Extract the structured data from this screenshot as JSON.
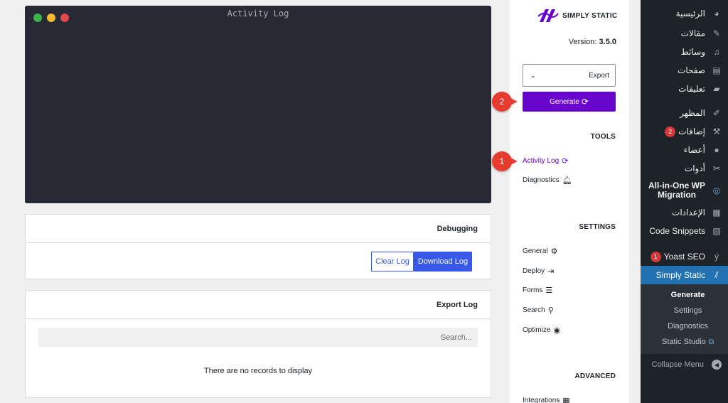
{
  "wp_menu": {
    "items": [
      {
        "label": "الرئيسية",
        "icon": "dashboard-icon"
      },
      {
        "label": "مقالات",
        "icon": "pin-icon"
      },
      {
        "label": "وسائط",
        "icon": "media-icon"
      },
      {
        "label": "صفحات",
        "icon": "pages-icon"
      },
      {
        "label": "تعليقات",
        "icon": "comments-icon"
      },
      {
        "label": "المظهر",
        "icon": "appearance-icon"
      },
      {
        "label": "إضافات",
        "icon": "plugins-icon",
        "badge": "2"
      },
      {
        "label": "أعضاء",
        "icon": "users-icon"
      },
      {
        "label": "أدوات",
        "icon": "tools-icon"
      },
      {
        "label": "All-in-One WP Migration",
        "icon": "migration-icon"
      },
      {
        "label": "الإعدادات",
        "icon": "settings-icon"
      },
      {
        "label": "Code Snippets",
        "icon": "code-snippets-icon"
      },
      {
        "label": "Yoast SEO",
        "icon": "yoast-icon",
        "badge": "1"
      },
      {
        "label": "Simply Static",
        "icon": "simply-static-icon"
      }
    ],
    "submenu": [
      {
        "label": "Generate"
      },
      {
        "label": "Settings"
      },
      {
        "label": "Diagnostics"
      },
      {
        "label": "Static Studio"
      }
    ],
    "collapse_label": "Collapse Menu"
  },
  "ss_panel": {
    "logo_text": "SIMPLY STATIC",
    "version_label": "Version:",
    "version_value": "3.5.0",
    "export_select": "Export",
    "generate_label": "Generate",
    "tools_heading": "TOOLS",
    "tools": [
      {
        "label": "Activity Log",
        "icon": "sync-icon"
      },
      {
        "label": "Diagnostics",
        "icon": "bell-icon"
      }
    ],
    "settings_heading": "SETTINGS",
    "settings": [
      {
        "label": "General",
        "icon": "gear-icon"
      },
      {
        "label": "Deploy",
        "icon": "deploy-icon"
      },
      {
        "label": "Forms",
        "icon": "forms-icon"
      },
      {
        "label": "Search",
        "icon": "search-icon"
      },
      {
        "label": "Optimize",
        "icon": "dashboard-gauge-icon"
      }
    ],
    "advanced_heading": "ADVANCED",
    "advanced": [
      {
        "label": "Integrations",
        "icon": "calendar-icon"
      }
    ],
    "accent": "#6804cc"
  },
  "terminal": {
    "title": "Activity Log",
    "dot_colors": [
      "#3cb44b",
      "#f5b82e",
      "#e2474b"
    ]
  },
  "debugging": {
    "title": "Debugging",
    "clear_label": "Clear Log",
    "download_label": "Download Log"
  },
  "export_log": {
    "title": "Export Log",
    "search_placeholder": "Search...",
    "empty_text": "There are no records to display"
  },
  "callouts": [
    "1",
    "2"
  ]
}
